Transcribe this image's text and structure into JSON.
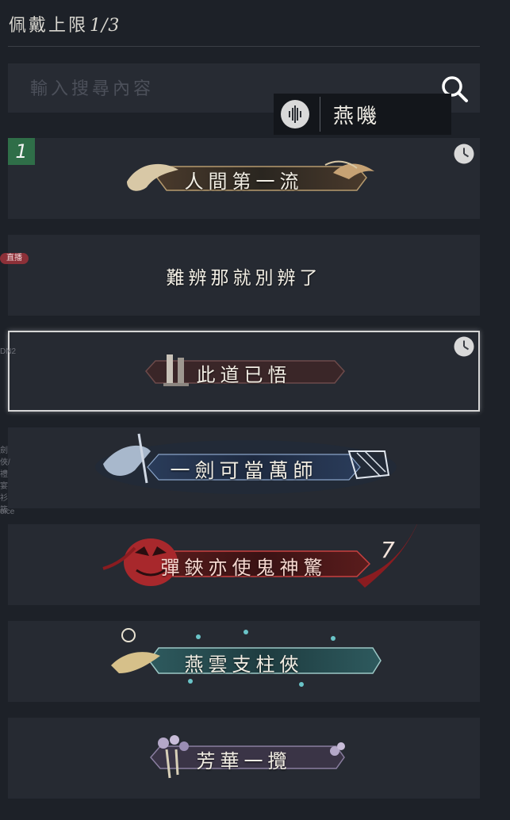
{
  "header": {
    "limit_label": "佩戴上限",
    "limit_count": "1/3"
  },
  "search": {
    "placeholder": "輸入搜尋內容",
    "value": ""
  },
  "voice_chip": {
    "name": "燕嘰"
  },
  "left_overlay": {
    "live_badge": "直播",
    "text_1": "DN2",
    "text_2": "劍俠/禮宴衫筱",
    "text_3": "oice"
  },
  "titles": [
    {
      "rank": "1",
      "name": "人間第一流",
      "has_clock": true
    },
    {
      "name": "難辨那就別辨了"
    },
    {
      "name": "此道已悟",
      "has_clock": true,
      "selected": true
    },
    {
      "name": "一劍可當萬師"
    },
    {
      "name": "彈鋏亦使鬼神驚",
      "badge": "7"
    },
    {
      "name": "燕雲支柱俠"
    },
    {
      "name": "芳華一攬"
    }
  ],
  "colors": {
    "background": "#1d2128",
    "card": "#262a32",
    "rank_badge": "#2f6e48",
    "selected_outline": "#d6d6d6"
  }
}
